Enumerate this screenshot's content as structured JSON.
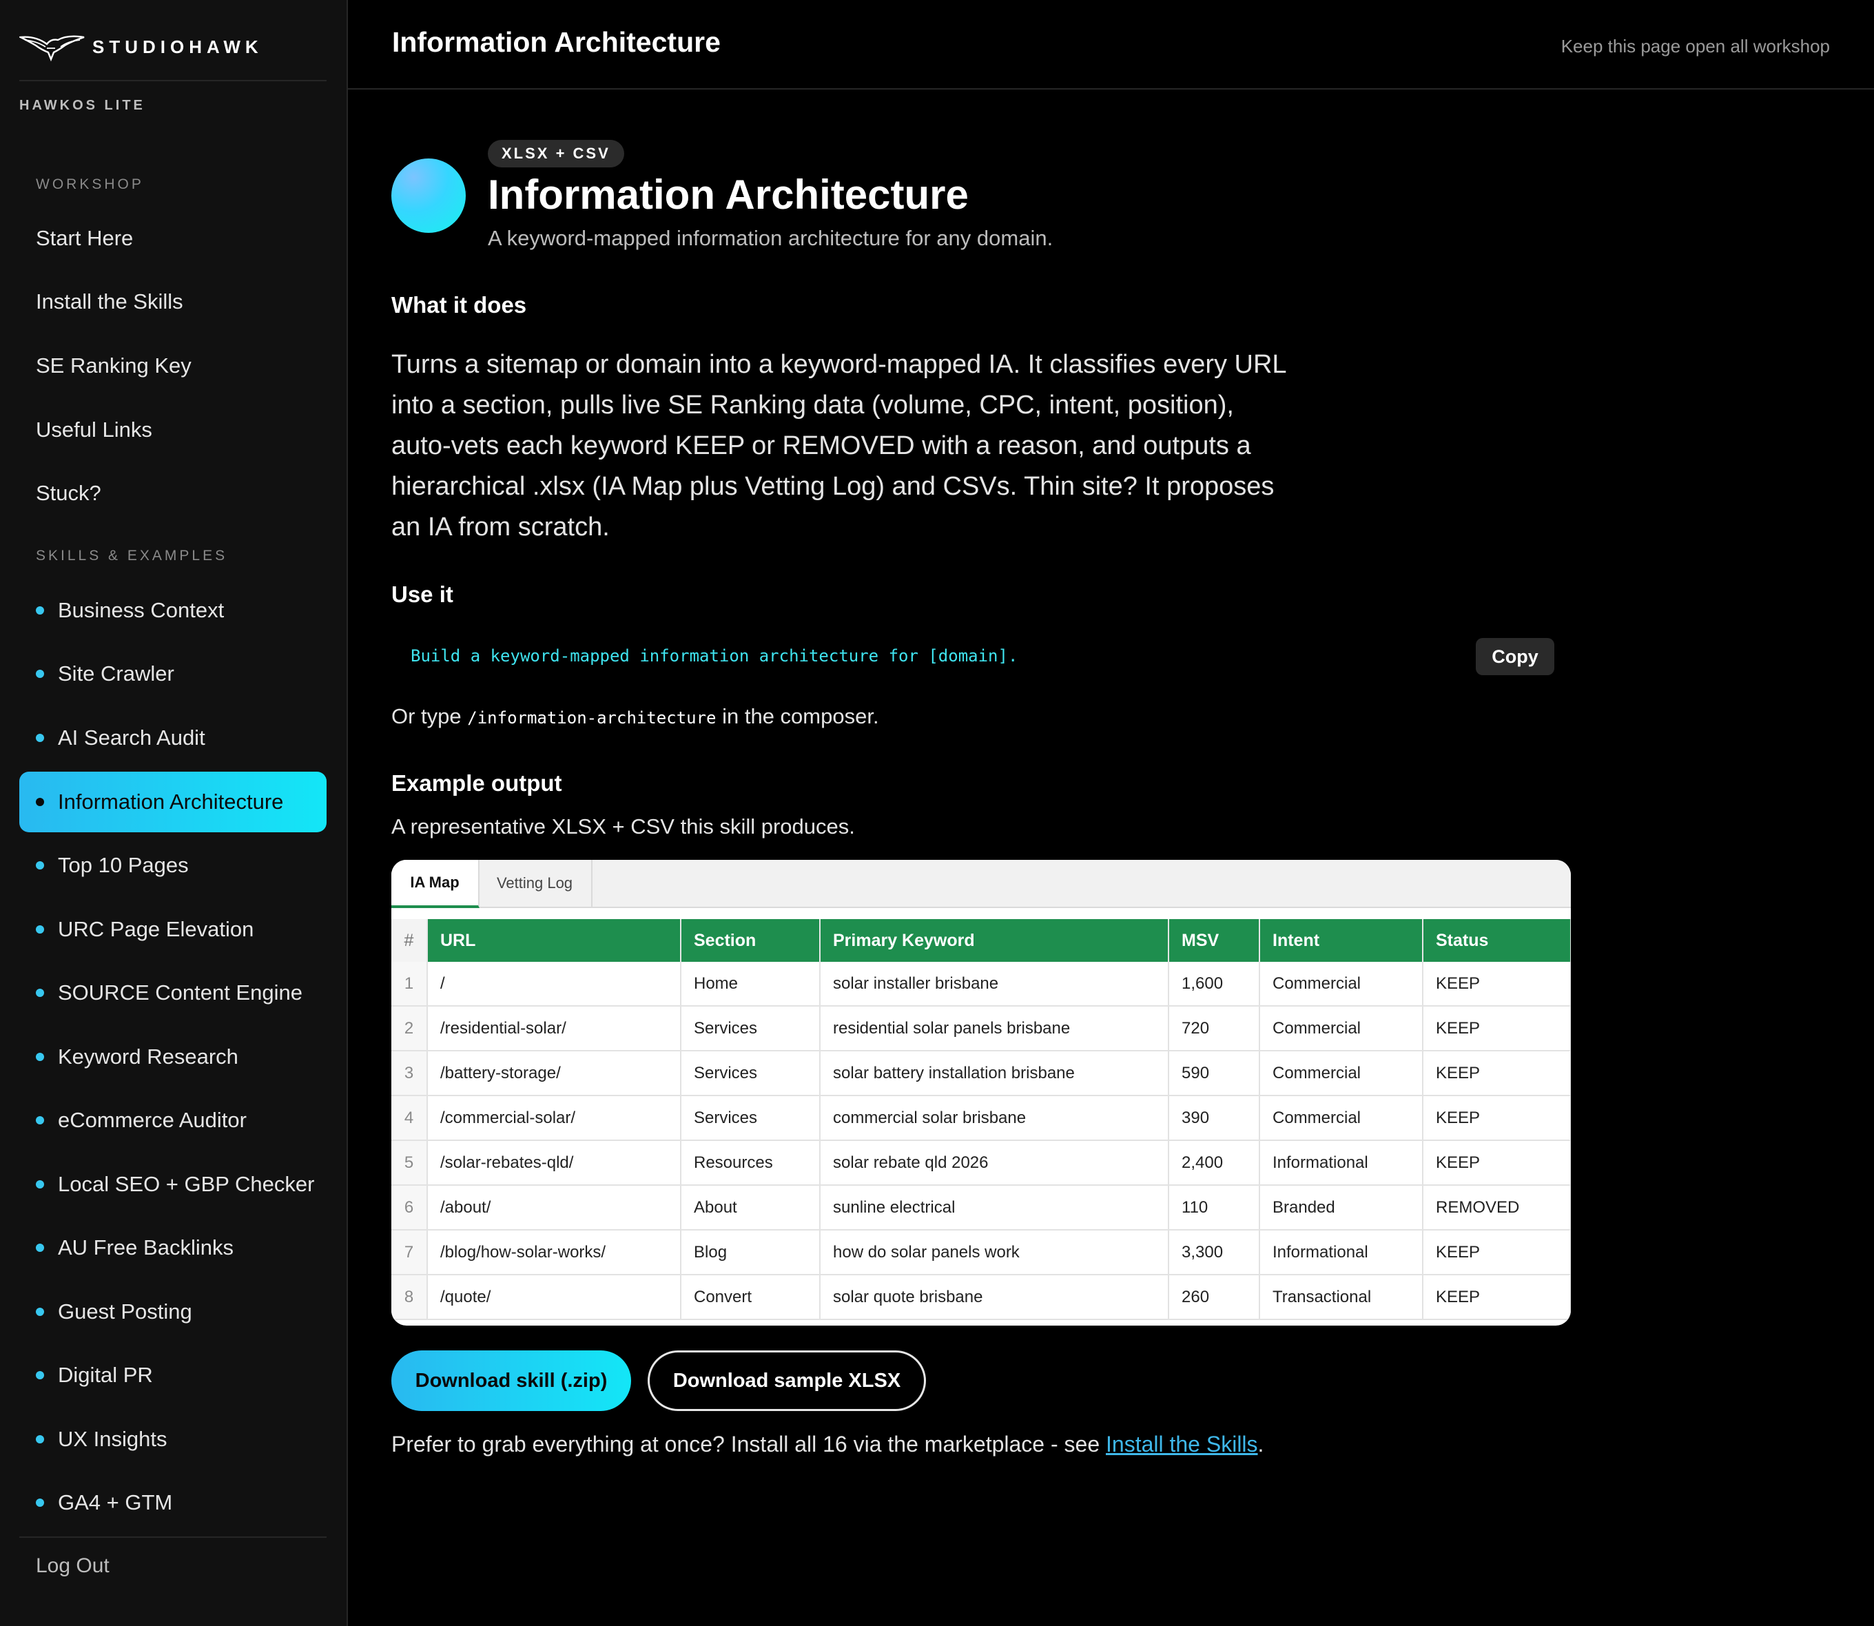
{
  "brand": {
    "name": "STUDIOHAWK",
    "product": "HAWKOS LITE",
    "logo_icon": "hawk-logo-icon"
  },
  "sidebar": {
    "workshop_label": "WORKSHOP",
    "workshop_items": [
      {
        "label": "Start Here"
      },
      {
        "label": "Install the Skills"
      },
      {
        "label": "SE Ranking Key"
      },
      {
        "label": "Useful Links"
      },
      {
        "label": "Stuck?"
      }
    ],
    "skills_label": "SKILLS & EXAMPLES",
    "skill_items": [
      {
        "label": "Business Context"
      },
      {
        "label": "Site Crawler"
      },
      {
        "label": "AI Search Audit"
      },
      {
        "label": "Information Architecture",
        "active": true
      },
      {
        "label": "Top 10 Pages"
      },
      {
        "label": "URC Page Elevation"
      },
      {
        "label": "SOURCE Content Engine"
      },
      {
        "label": "Keyword Research"
      },
      {
        "label": "eCommerce Auditor"
      },
      {
        "label": "Local SEO + GBP Checker"
      },
      {
        "label": "AU Free Backlinks"
      },
      {
        "label": "Guest Posting"
      },
      {
        "label": "Digital PR"
      },
      {
        "label": "UX Insights"
      },
      {
        "label": "GA4 + GTM"
      }
    ],
    "logout_label": "Log Out"
  },
  "header": {
    "title": "Information Architecture",
    "note": "Keep this page open all workshop"
  },
  "skill": {
    "badge": "XLSX + CSV",
    "title": "Information Architecture",
    "subtitle": "A keyword-mapped information architecture for any domain.",
    "what_heading": "What it does",
    "what_body": "Turns a sitemap or domain into a keyword-mapped IA. It classifies every URL into a section, pulls live SE Ranking data (volume, CPC, intent, position), auto-vets each keyword KEEP or REMOVED with a reason, and outputs a hierarchical .xlsx (IA Map plus Vetting Log) and CSVs. Thin site? It proposes an IA from scratch.",
    "use_heading": "Use it",
    "prompt": "Build a keyword-mapped information architecture for [domain].",
    "copy_label": "Copy",
    "or_type_prefix": "Or type ",
    "command": "/information-architecture",
    "or_type_suffix": " in the composer.",
    "example_heading": "Example output",
    "example_desc": "A representative XLSX + CSV this skill produces."
  },
  "example": {
    "tabs": [
      {
        "label": "IA Map",
        "active": true
      },
      {
        "label": "Vetting Log"
      }
    ],
    "columns": [
      "#",
      "URL",
      "Section",
      "Primary Keyword",
      "MSV",
      "Intent",
      "Status"
    ],
    "rows": [
      [
        "1",
        "/",
        "Home",
        "solar installer brisbane",
        "1,600",
        "Commercial",
        "KEEP"
      ],
      [
        "2",
        "/residential-solar/",
        "Services",
        "residential solar panels brisbane",
        "720",
        "Commercial",
        "KEEP"
      ],
      [
        "3",
        "/battery-storage/",
        "Services",
        "solar battery installation brisbane",
        "590",
        "Commercial",
        "KEEP"
      ],
      [
        "4",
        "/commercial-solar/",
        "Services",
        "commercial solar brisbane",
        "390",
        "Commercial",
        "KEEP"
      ],
      [
        "5",
        "/solar-rebates-qld/",
        "Resources",
        "solar rebate qld 2026",
        "2,400",
        "Informational",
        "KEEP"
      ],
      [
        "6",
        "/about/",
        "About",
        "sunline electrical",
        "110",
        "Branded",
        "REMOVED"
      ],
      [
        "7",
        "/blog/how-solar-works/",
        "Blog",
        "how do solar panels work",
        "3,300",
        "Informational",
        "KEEP"
      ],
      [
        "8",
        "/quote/",
        "Convert",
        "solar quote brisbane",
        "260",
        "Transactional",
        "KEEP"
      ]
    ],
    "header_color": "#1e8e4e"
  },
  "actions": {
    "download_skill": "Download skill (.zip)",
    "download_sample": "Download sample XLSX",
    "footer_prefix": "Prefer to grab everything at once? Install all 16 via the marketplace - see ",
    "footer_link": "Install the Skills",
    "footer_suffix": "."
  },
  "colors": {
    "accent_start": "#29b9f0",
    "accent_end": "#13e6f7",
    "code": "#3fe3ef",
    "link": "#3fb8ea"
  }
}
